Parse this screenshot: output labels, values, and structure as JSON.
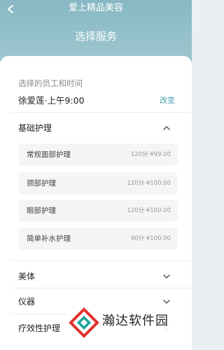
{
  "header": {
    "back_icon": "chevron-left-icon",
    "app_title": "爱上精品美容",
    "page_title": "选择服务",
    "background_color": "#88b8c3"
  },
  "employee": {
    "label": "选择的员工和时间",
    "value": "徐爱莲·上午9:00",
    "change_label": "改变",
    "change_color": "#4da3b3"
  },
  "sections": [
    {
      "label": "基础护理",
      "expanded": true,
      "chevron_icon": "chevron-up-icon",
      "items": [
        {
          "name": "常规面部护理",
          "price": "120分·¥99.00"
        },
        {
          "name": "颈部护理",
          "price": "120分·¥100.00"
        },
        {
          "name": "眼部护理",
          "price": "120分·¥100.00"
        },
        {
          "name": "简单补水护理",
          "price": "90分·¥100.00"
        }
      ]
    },
    {
      "label": "美体",
      "expanded": false,
      "chevron_icon": "chevron-down-icon"
    },
    {
      "label": "仪器",
      "expanded": false,
      "chevron_icon": "chevron-down-icon"
    },
    {
      "label": "疗效性护理",
      "expanded": false,
      "chevron_icon": "chevron-down-icon"
    }
  ],
  "watermark": {
    "text": "瀚达软件园",
    "logo_icon": "handa-logo-icon"
  }
}
